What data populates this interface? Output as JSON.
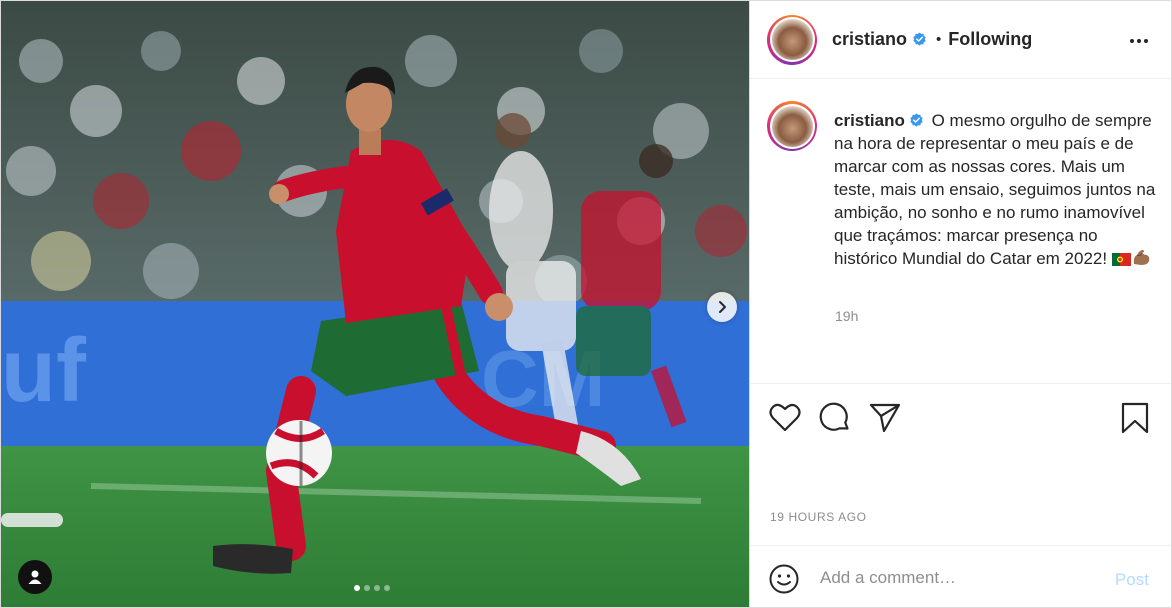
{
  "post": {
    "username": "cristiano",
    "separator": "•",
    "follow_status": "Following",
    "caption": "O mesmo orgulho de sempre na hora de representar o meu país e de marcar com as nossas cores. Mais um teste, mais um ensaio, seguimos juntos na ambição, no sonho e no rumo inamovível que traçámos: marcar presença no histórico Mundial do Catar em 2022!",
    "caption_emojis": "🇵🇹💪🏽",
    "caption_age": "19h",
    "timestamp": "19 HOURS AGO",
    "carousel": {
      "slide_count": 4,
      "active_index": 0
    }
  },
  "comment": {
    "placeholder": "Add a comment…",
    "post_label": "Post"
  },
  "icons": {
    "verified": "verified-badge-icon",
    "more": "more-options-icon",
    "like": "heart-icon",
    "comment": "comment-bubble-icon",
    "share": "paper-plane-icon",
    "save": "bookmark-icon",
    "emoji": "smiley-icon",
    "next": "chevron-right-icon",
    "tags": "user-tag-icon"
  },
  "colors": {
    "verified": "#3897f0",
    "post_disabled": "#b3dbff",
    "muted_text": "#8e8e8e",
    "jersey_red": "#c8102e",
    "shorts_green": "#1e6b34"
  }
}
